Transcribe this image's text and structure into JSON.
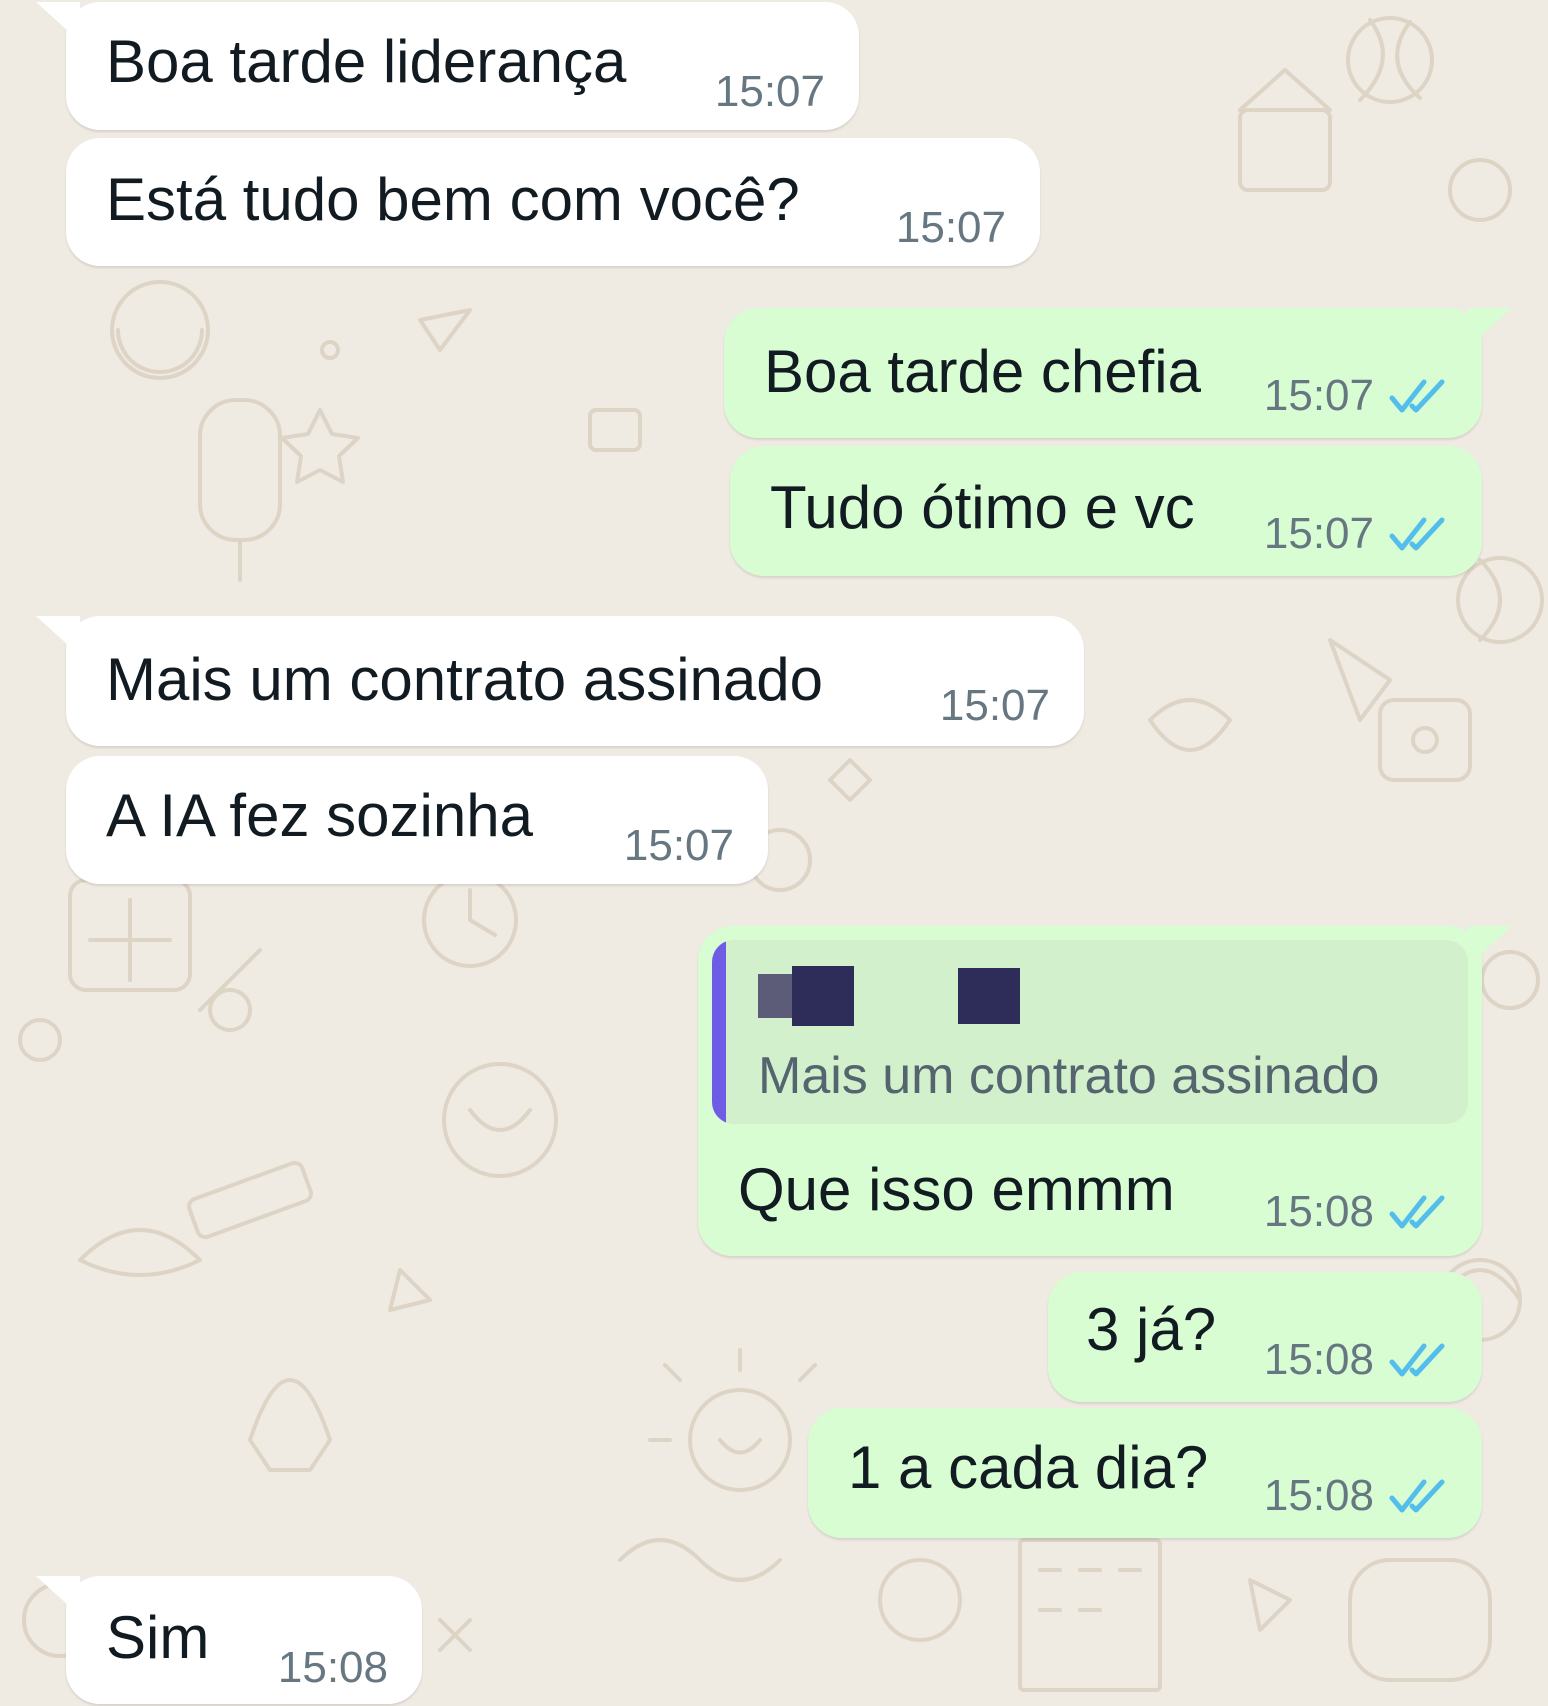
{
  "messages": [
    {
      "direction": "incoming",
      "text": "Boa tarde liderança",
      "time": "15:07"
    },
    {
      "direction": "incoming",
      "text": "Está tudo bem com você?",
      "time": "15:07"
    },
    {
      "direction": "outgoing",
      "text": "Boa tarde chefia",
      "time": "15:07",
      "status": "read"
    },
    {
      "direction": "outgoing",
      "text": "Tudo ótimo e vc",
      "time": "15:07",
      "status": "read"
    },
    {
      "direction": "incoming",
      "text": "Mais um contrato assinado",
      "time": "15:07"
    },
    {
      "direction": "incoming",
      "text": "A IA fez sozinha",
      "time": "15:07"
    },
    {
      "direction": "outgoing",
      "text": "Que isso emmm",
      "time": "15:08",
      "status": "read",
      "reply_to": {
        "author": "[redacted]",
        "text": "Mais um contrato assinado"
      }
    },
    {
      "direction": "outgoing",
      "text": "3 já?",
      "time": "15:08",
      "status": "read"
    },
    {
      "direction": "outgoing",
      "text": "1 a cada dia?",
      "time": "15:08",
      "status": "read"
    },
    {
      "direction": "incoming",
      "text": "Sim",
      "time": "15:08"
    }
  ],
  "colors": {
    "background": "#efeae2",
    "incoming_bubble": "#ffffff",
    "outgoing_bubble": "#d9fdd3",
    "read_ticks": "#53bdeb",
    "quote_bar": "#6e5ce6"
  },
  "icons": {
    "read_receipt": "double-check-icon"
  }
}
